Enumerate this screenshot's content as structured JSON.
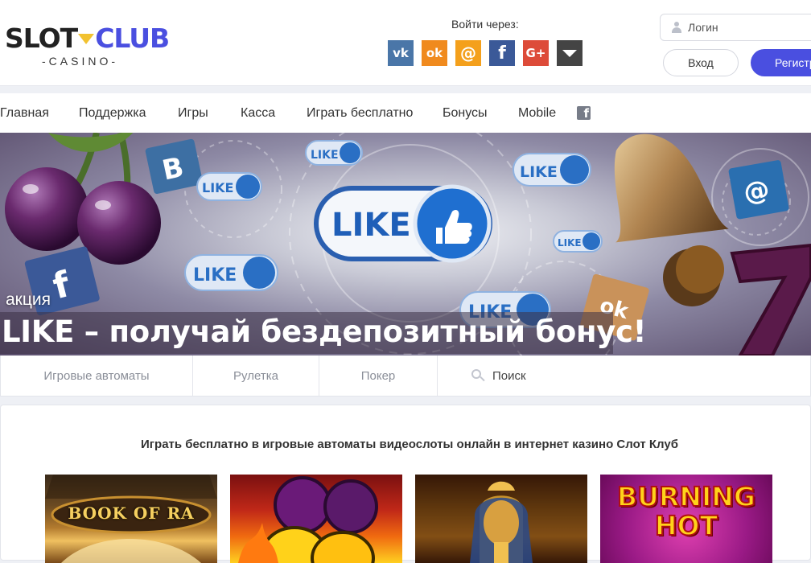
{
  "header": {
    "logo": {
      "word1": "SLOT",
      "word2": "CLUB",
      "sub": "-CASINO-"
    },
    "social": {
      "label": "Войти через:",
      "buttons": [
        {
          "icon": "vk-icon",
          "glyph": "vk"
        },
        {
          "icon": "odnoklassniki-icon",
          "glyph": "ok"
        },
        {
          "icon": "mailru-icon",
          "glyph": "@"
        },
        {
          "icon": "facebook-icon",
          "glyph": "f"
        },
        {
          "icon": "google-plus-icon",
          "glyph": "G+"
        },
        {
          "icon": "more-icon",
          "glyph": ""
        }
      ]
    },
    "login_placeholder": "Логин",
    "enter_label": "Вход",
    "register_label": "Регистрация"
  },
  "nav": {
    "items": [
      "Главная",
      "Поддержка",
      "Игры",
      "Касса",
      "Играть бесплатно",
      "Бонусы",
      "Mobile"
    ],
    "fb_glyph": "f"
  },
  "banner": {
    "tag": "акция",
    "title": "LIKE – получай бездепозитный бонус!",
    "badges": {
      "like": "LIKE",
      "vk": "В",
      "fb": "f",
      "mail": "@",
      "ok": "ok"
    }
  },
  "tabs": {
    "items": [
      "Игровые автоматы",
      "Рулетка",
      "Покер"
    ],
    "search_placeholder": "Поиск"
  },
  "content": {
    "title": "Играть бесплатно в игровые автоматы видеослоты онлайн в интернет казино Слот Клуб",
    "games": [
      {
        "name": "book-of-ra",
        "title": "BOOK OF RA"
      },
      {
        "name": "fruit-slot",
        "title": ""
      },
      {
        "name": "pharaoh-slot",
        "title": ""
      },
      {
        "name": "burning-hot",
        "title": "BURNING\nHOT"
      }
    ]
  },
  "colors": {
    "accent": "#4a4fe0",
    "gem": "#f2c230",
    "like_blue": "#1f6fd0"
  }
}
